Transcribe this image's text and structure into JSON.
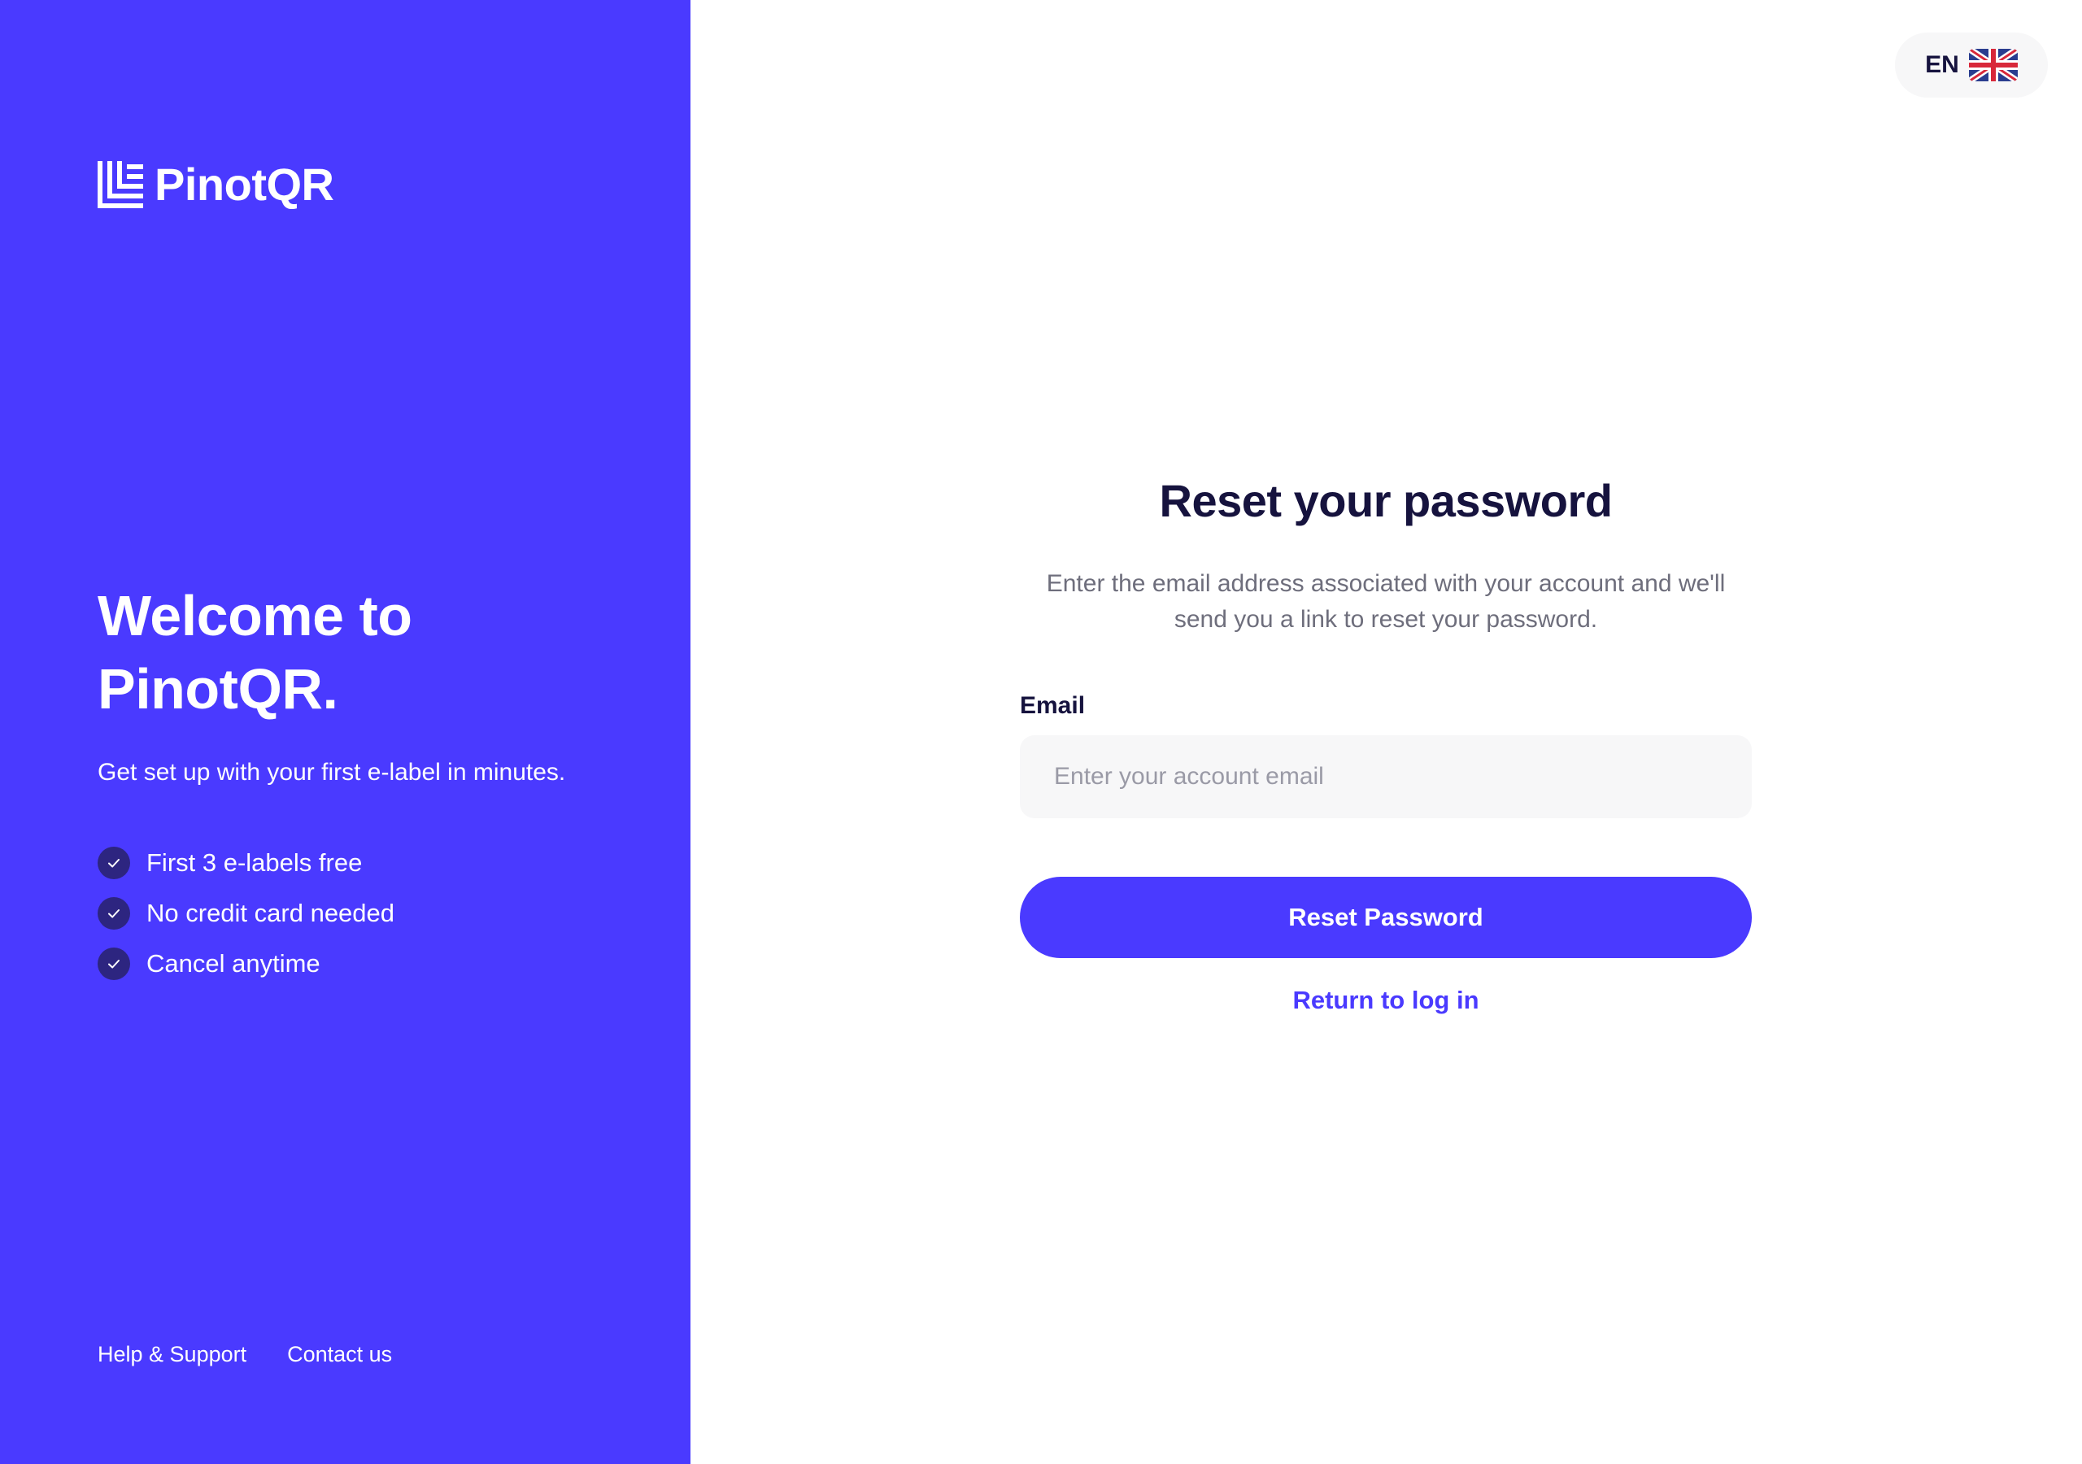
{
  "brand": {
    "name": "PinotQR",
    "logo_icon": "pinotqr-logo-icon"
  },
  "hero": {
    "title": "Welcome to PinotQR.",
    "subtitle": "Get set up with your first e-label in minutes.",
    "features": [
      {
        "label": "First 3 e-labels free",
        "icon": "check-icon"
      },
      {
        "label": "No credit card needed",
        "icon": "check-icon"
      },
      {
        "label": "Cancel anytime",
        "icon": "check-icon"
      }
    ]
  },
  "footer": {
    "help": "Help & Support",
    "contact": "Contact us"
  },
  "language": {
    "code": "EN",
    "flag_icon": "uk-flag-icon"
  },
  "form": {
    "title": "Reset your password",
    "description": "Enter the email address associated with your account and we'll send you a link to reset your password.",
    "email_label": "Email",
    "email_value": "",
    "email_placeholder": "Enter your account email",
    "submit_label": "Reset Password",
    "return_label": "Return to log in"
  },
  "colors": {
    "brand_primary": "#4a3aff",
    "check_badge": "#2d2580",
    "heading_text": "#16133e",
    "muted_text": "#6e6e7c",
    "input_bg": "#f7f7f8"
  }
}
